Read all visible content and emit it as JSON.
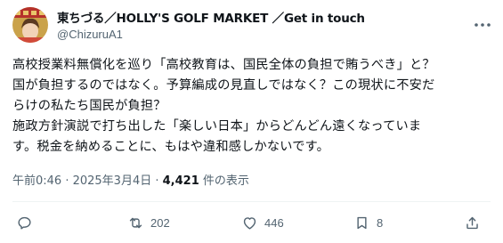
{
  "author": {
    "display_name": "東ちづる／HOLLY'S GOLF MARKET ／Get in touch",
    "handle": "@ChizuruA1"
  },
  "post": {
    "lines": [
      "高校授業料無償化を巡り「高校教育は、国民全体の負担で賄うべき」と？",
      "国が負担するのではなく。予算編成の見直しではなく？この現状に不安だ",
      "らけの私たち国民が負担？",
      "施政方針演説で打ち出した「楽しい日本」からどんどん遠くなっていま",
      "す。税金を納めることに、もはや違和感しかないです。"
    ]
  },
  "meta": {
    "timestamp": "午前0:46 · 2025年3月4日 · ",
    "views": "4,421",
    "views_label": " 件の表示"
  },
  "actions": {
    "reply_count": "",
    "repost_count": "202",
    "like_count": "446",
    "bookmark_count": "8",
    "icons": [
      "reply-icon",
      "repost-icon",
      "like-icon",
      "bookmark-icon",
      "share-icon"
    ]
  },
  "colors": {
    "text_primary": "#0f1419",
    "text_secondary": "#536471",
    "divider": "#eff3f4"
  }
}
